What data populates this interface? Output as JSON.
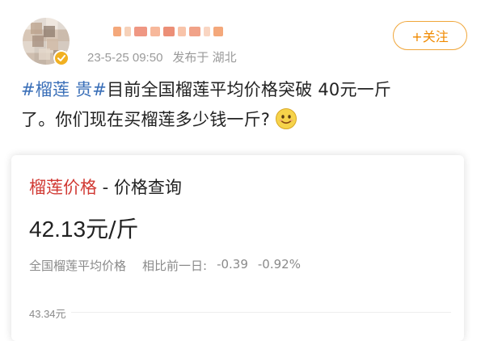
{
  "post": {
    "meta_time": "23-5-25 09:50",
    "meta_source": "发布于 湖北",
    "follow_label": "+关注",
    "hashtag": "#榴莲 贵#",
    "line1_rest": "目前全国榴莲平均价格突破 40元一斤",
    "line2": "了。你们现在买榴莲多少钱一斤?"
  },
  "card": {
    "brand": "榴莲价格",
    "title_rest": " - 价格查询",
    "price_value": "42.13",
    "price_unit": "元/斤",
    "stat_label": "全国榴莲平均价格",
    "stat_compare": "相比前一日:",
    "stat_change": "-0.39",
    "stat_percent": "-0.92%",
    "axis_top": "43.34元"
  },
  "icons": {
    "verified": "verified-badge-icon",
    "emoji": "smiling-emoji-icon"
  },
  "colors": {
    "accent_orange": "#f08a00",
    "hashtag_blue": "#3a6fb8",
    "brand_red": "#d13a34",
    "verified_gold": "#f1b021"
  }
}
